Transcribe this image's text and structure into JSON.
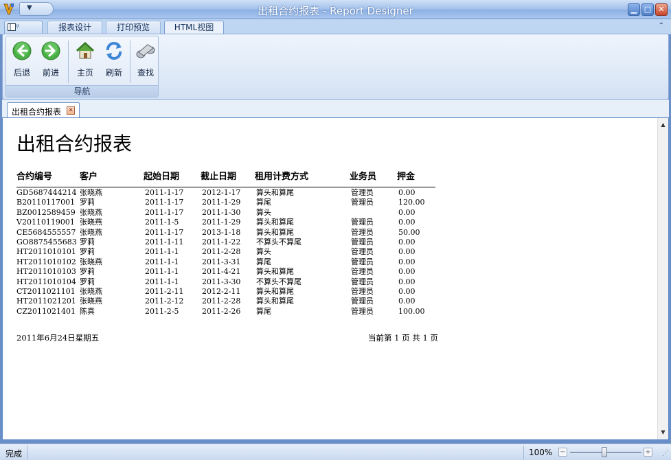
{
  "window": {
    "title": "出租合约报表 - Report Designer",
    "controls": [
      "minimize",
      "maximize",
      "close"
    ]
  },
  "ribbon": {
    "tabs": [
      {
        "label": "报表设计",
        "active": false
      },
      {
        "label": "打印预览",
        "active": false
      },
      {
        "label": "HTML视图",
        "active": true
      }
    ],
    "group_label": "导航",
    "buttons": [
      {
        "label": "后退",
        "icon": "back-arrow-icon"
      },
      {
        "label": "前进",
        "icon": "forward-arrow-icon"
      },
      {
        "label": "主页",
        "icon": "home-icon"
      },
      {
        "label": "刷新",
        "icon": "refresh-icon"
      },
      {
        "label": "查找",
        "icon": "binoculars-icon"
      }
    ]
  },
  "document_tab": {
    "label": "出租合约报表"
  },
  "report": {
    "title": "出租合约报表",
    "headers": [
      "合约编号",
      "客户",
      "起始日期",
      "截止日期",
      "租用计费方式",
      "业务员",
      "押金"
    ],
    "rows": [
      [
        "GD5687444214",
        "张晓燕",
        "2011-1-17",
        "2012-1-17",
        "算头和算尾",
        "管理员",
        "0.00"
      ],
      [
        "B20110117001",
        "罗莉",
        "2011-1-17",
        "2011-1-29",
        "算尾",
        "管理员",
        "120.00"
      ],
      [
        "BZ0012589459",
        "张晓燕",
        "2011-1-17",
        "2011-1-30",
        "算头",
        "",
        "0.00"
      ],
      [
        "V20110119001",
        "张晓燕",
        "2011-1-5",
        "2011-1-29",
        "算头和算尾",
        "管理员",
        "0.00"
      ],
      [
        "CE5684555557",
        "张晓燕",
        "2011-1-17",
        "2013-1-18",
        "算头和算尾",
        "管理员",
        "50.00"
      ],
      [
        "GO8875455683",
        "罗莉",
        "2011-1-11",
        "2011-1-22",
        "不算头不算尾",
        "管理员",
        "0.00"
      ],
      [
        "HT2011010101",
        "罗莉",
        "2011-1-1",
        "2011-2-28",
        "算头",
        "管理员",
        "0.00"
      ],
      [
        "HT2011010102",
        "张晓燕",
        "2011-1-1",
        "2011-3-31",
        "算尾",
        "管理员",
        "0.00"
      ],
      [
        "HT2011010103",
        "罗莉",
        "2011-1-1",
        "2011-4-21",
        "算头和算尾",
        "管理员",
        "0.00"
      ],
      [
        "HT2011010104",
        "罗莉",
        "2011-1-1",
        "2011-3-30",
        "不算头不算尾",
        "管理员",
        "0.00"
      ],
      [
        "CT2011021101",
        "张晓燕",
        "2011-2-11",
        "2012-2-11",
        "算头和算尾",
        "管理员",
        "0.00"
      ],
      [
        "HT2011021201",
        "张晓燕",
        "2011-2-12",
        "2011-2-28",
        "算头和算尾",
        "管理员",
        "0.00"
      ],
      [
        "CZ2011021401",
        "陈真",
        "2011-2-5",
        "2011-2-26",
        "算尾",
        "管理员",
        "100.00"
      ]
    ],
    "footer_date": "2011年6月24日星期五",
    "footer_page": "当前第 1 页 共 1 页"
  },
  "statusbar": {
    "status": "完成",
    "zoom": "100%"
  },
  "colors": {
    "titlebar": "#a7c4ec",
    "content_border": "#5c87c5",
    "back_icon": "#3aa33a"
  }
}
